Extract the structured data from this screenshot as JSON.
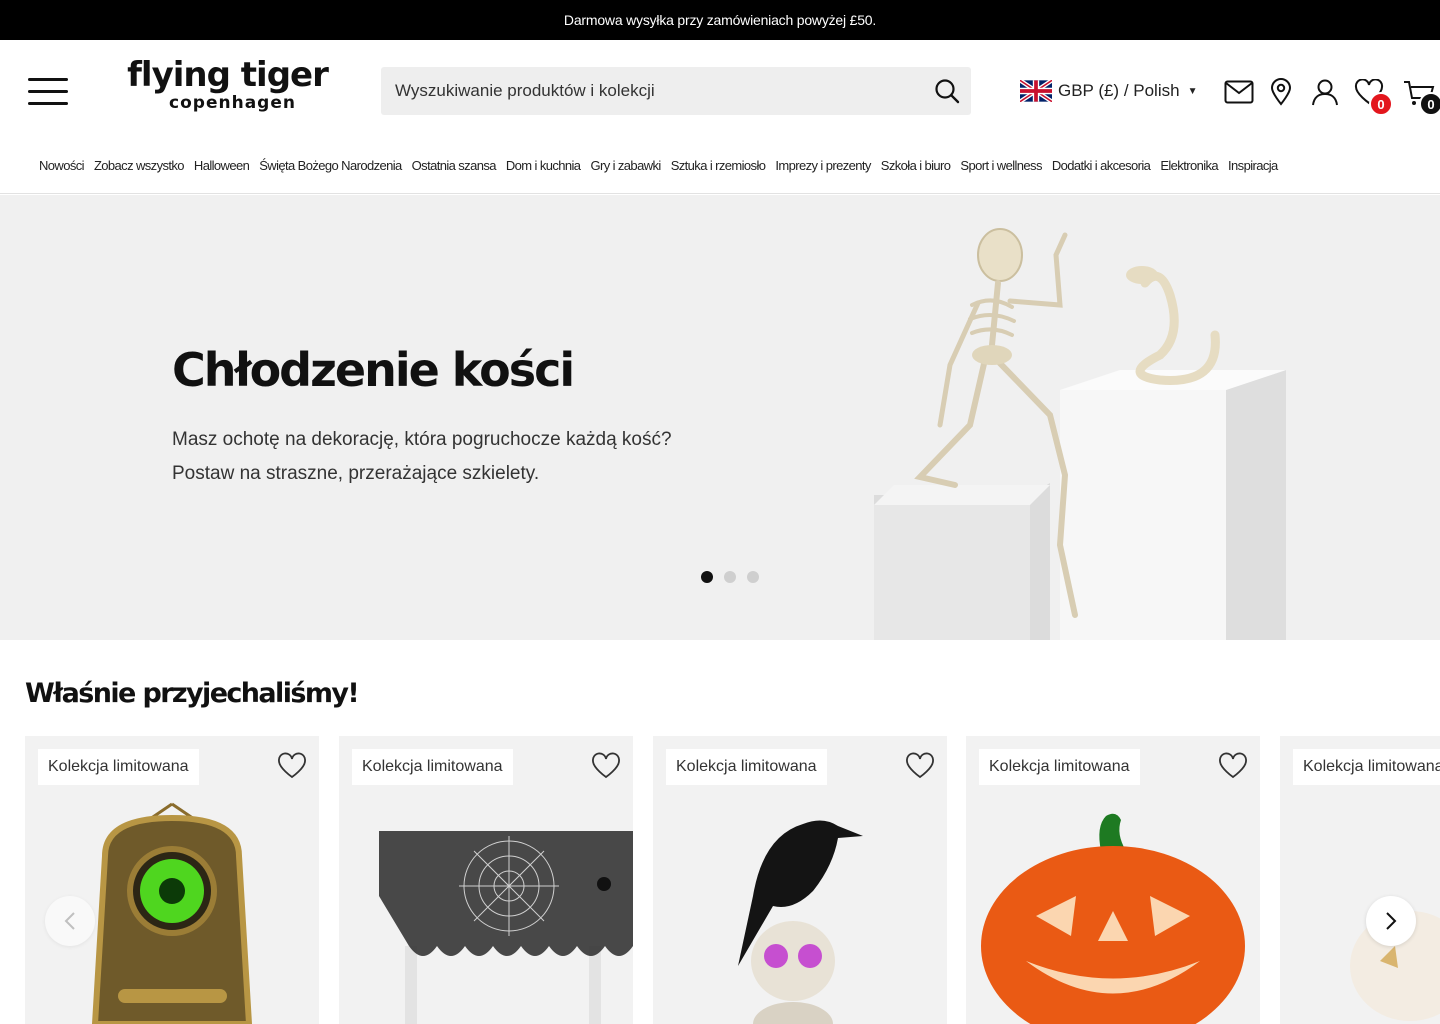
{
  "announcement": "Darmowa wysyłka przy zamówieniach powyżej £50.",
  "logo": {
    "line1": "flying tiger",
    "line2": "copenhagen"
  },
  "search": {
    "placeholder": "Wyszukiwanie produktów i kolekcji",
    "value": ""
  },
  "locale": {
    "label": "GBP (£) / Polish"
  },
  "header_icons": {
    "wishlist_count": "0",
    "cart_count": "0"
  },
  "nav": {
    "items": [
      "Nowości",
      "Zobacz wszystko",
      "Halloween",
      "Święta Bożego Narodzenia",
      "Ostatnia szansa",
      "Dom i kuchnia",
      "Gry i zabawki",
      "Sztuka i rzemiosło",
      "Imprezy i prezenty",
      "Szkoła i biuro",
      "Sport i wellness",
      "Dodatki i akcesoria",
      "Elektronika",
      "Inspiracja"
    ]
  },
  "hero": {
    "title": "Chłodzenie kości",
    "text_line1": "Masz ochotę na dekorację, która pogruchocze każdą kość?",
    "text_line2": "Postaw na straszne, przerażające szkielety.",
    "slides": 3,
    "active_slide": 1
  },
  "section": {
    "title": "Właśnie przyjechaliśmy!"
  },
  "products": [
    {
      "tag": "Kolekcja limitowana",
      "icon": "haunted-doorbell"
    },
    {
      "tag": "Kolekcja limitowana",
      "icon": "spiderweb-tablecloth"
    },
    {
      "tag": "Kolekcja limitowana",
      "icon": "crow-on-skull"
    },
    {
      "tag": "Kolekcja limitowana",
      "icon": "ceramic-pumpkin"
    },
    {
      "tag": "Kolekcja limitowana",
      "icon": "white-pumpkin"
    }
  ],
  "colors": {
    "badge_wishlist": "#e3161d",
    "badge_cart": "#111111",
    "topbar": "#000000"
  }
}
